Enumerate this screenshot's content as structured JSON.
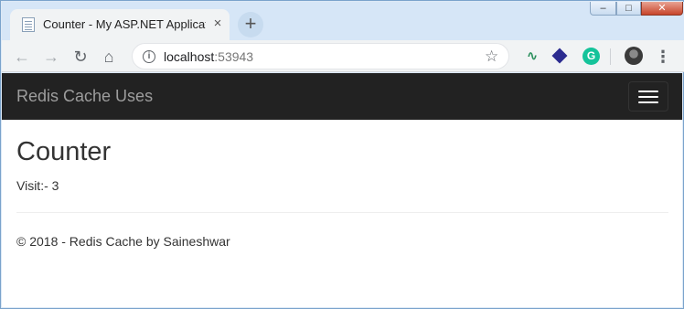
{
  "browser": {
    "tab_title": "Counter - My ASP.NET Applicatic",
    "tab_close": "×",
    "new_tab": "+",
    "url_host": "localhost",
    "url_port": ":53943",
    "window_buttons": {
      "minimize": "–",
      "maximize": "□",
      "close": "✕"
    },
    "icons": {
      "back": "←",
      "forward": "→",
      "reload": "↻",
      "home": "⌂",
      "info": "i",
      "star": "☆",
      "ext_grammarly": "G",
      "menu": "⋮"
    }
  },
  "navbar": {
    "brand": "Redis Cache Uses",
    "background": "#222222"
  },
  "main": {
    "title": "Counter",
    "visit_text": "Visit:- 3"
  },
  "footer": {
    "text": "© 2018 - Redis Cache by Saineshwar"
  }
}
